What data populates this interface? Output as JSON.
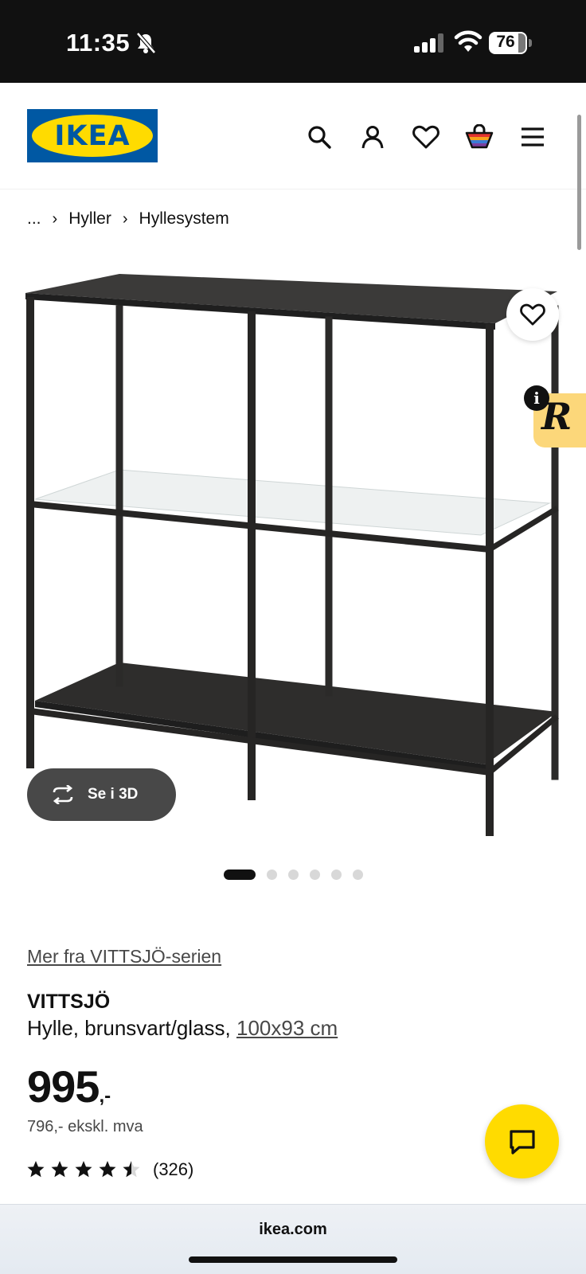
{
  "status_bar": {
    "time": "11:35",
    "battery": "76"
  },
  "header": {
    "logo_text": "IKEA"
  },
  "breadcrumb": {
    "ellipsis": "...",
    "items": [
      "Hyller",
      "Hyllesystem"
    ]
  },
  "media": {
    "view_3d_label": "Se i 3D",
    "slide_count": 6,
    "active_slide": 1
  },
  "product": {
    "series_link": "Mer fra VITTSJÖ-serien",
    "name": "VITTSJÖ",
    "description": "Hylle, brunsvart/glass,",
    "size_link": "100x93 cm",
    "price": "995",
    "price_suffix": ",-",
    "price_ex_vat": "796,- ekskl. mva",
    "rating_value": 4.5,
    "rating_count": "(326)"
  },
  "browser": {
    "url": "ikea.com"
  },
  "colors": {
    "ikea_blue": "#0058a3",
    "ikea_yellow": "#ffdb00",
    "dark_button": "#484848"
  }
}
